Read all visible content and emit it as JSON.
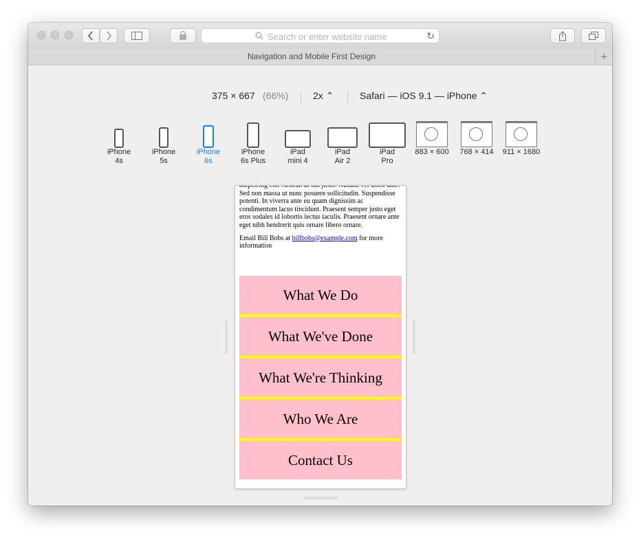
{
  "toolbar": {
    "url_placeholder": "Search or enter website name",
    "icons": [
      "back-icon",
      "forward-icon",
      "sidebar-icon",
      "privacy-icon",
      "search-icon",
      "reload-icon",
      "share-icon",
      "tabs-icon"
    ]
  },
  "tab": {
    "title": "Navigation and Mobile First Design",
    "new_tab": "+"
  },
  "rdm": {
    "dimensions": "375 × 667",
    "zoom": "(66%)",
    "scale": "2x ⌃",
    "user_agent": "Safari — iOS 9.1 — iPhone ⌃"
  },
  "devices": [
    {
      "line1": "iPhone",
      "line2": "4s"
    },
    {
      "line1": "iPhone",
      "line2": "5s"
    },
    {
      "line1": "iPhone",
      "line2": "6s",
      "selected": true
    },
    {
      "line1": "iPhone",
      "line2": "6s Plus"
    },
    {
      "line1": "iPad",
      "line2": "mini 4"
    },
    {
      "line1": "iPad",
      "line2": "Air 2"
    },
    {
      "line1": "iPad",
      "line2": "Pro"
    },
    {
      "line1": "883 × 600",
      "line2": ""
    },
    {
      "line1": "768 × 414",
      "line2": ""
    },
    {
      "line1": "911 × 1680",
      "line2": ""
    }
  ],
  "page": {
    "paragraph": "adipiscing elit. Aenean ut dui justo. Nullam vel dolor ante. Sed non massa ut nunc posuere sollicitudin. Suspendisse potenti. In viverra ante eu quam dignissim ac condimentum lacus tincidunt. Praesent semper justo eget eros sodales id lobortis lectus iaculis. Praesent ornare ante eget nibh hendrerit quis ornare libero ornare.",
    "email_prefix": "Email Bill Bobs at ",
    "email_link": "billbobs@example.com",
    "email_suffix": " for more information",
    "nav": [
      "What We Do",
      "What We've Done",
      "What We're Thinking",
      "Who We Are",
      "Contact Us"
    ]
  },
  "colors": {
    "nav_background": "#ffc0cb",
    "nav_divider": "#ffff00",
    "selected_device": "#1a7cf4"
  }
}
